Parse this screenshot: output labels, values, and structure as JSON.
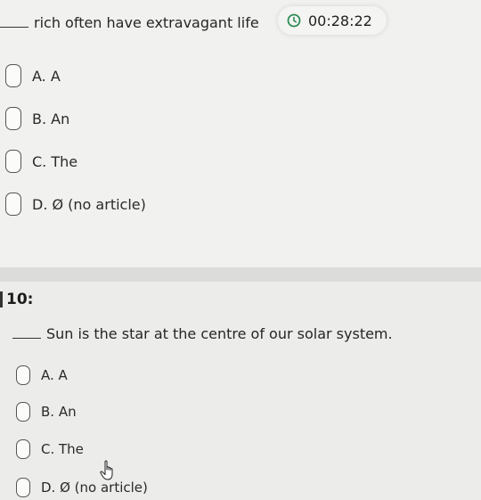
{
  "question_prev": {
    "text": "rich often have extravagant life",
    "options": [
      "A. A",
      "B. An",
      "C. The",
      "D. Ø (no article)"
    ]
  },
  "timer": {
    "icon": "clock-icon",
    "value": "00:28:22",
    "accent": "#2e8b57"
  },
  "question_10": {
    "number": "10:",
    "text": "Sun is the star at the centre of our solar system.",
    "options": [
      "A. A",
      "B. An",
      "C. The",
      "D. Ø (no article)"
    ]
  }
}
